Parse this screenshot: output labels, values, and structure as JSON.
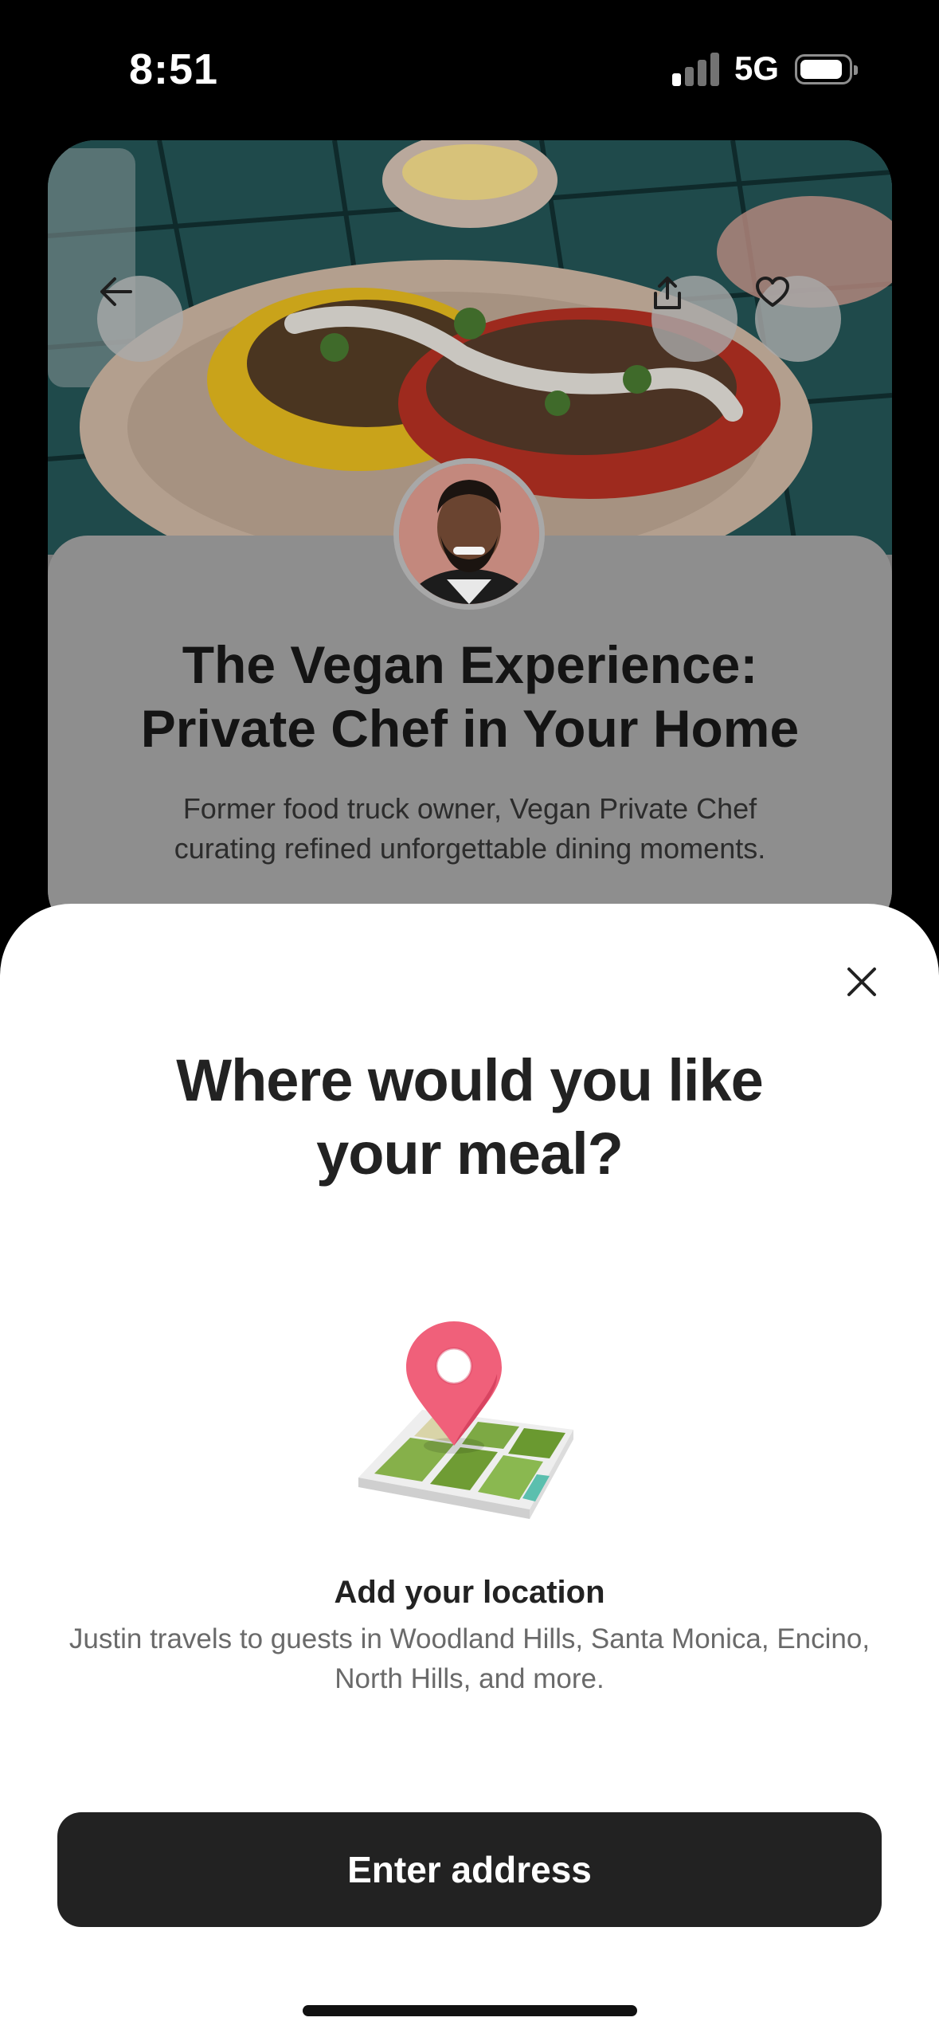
{
  "status_bar": {
    "time": "8:51",
    "network": "5G",
    "battery_level": 0.85
  },
  "listing": {
    "title_line1": "The Vegan Experience:",
    "title_line2": "Private Chef in Your Home",
    "description_line1": "Former food truck owner, Vegan Private Chef",
    "description_line2": "curating refined unforgettable dining moments.",
    "back_icon": "arrow-left-icon",
    "share_icon": "share-icon",
    "favorite_icon": "heart-icon"
  },
  "sheet": {
    "title_line1": "Where would you like",
    "title_line2": "your meal?",
    "close_icon": "close-icon",
    "location_heading": "Add your location",
    "location_desc_line1": "Justin travels to guests in Woodland Hills, Santa Monica, Encino,",
    "location_desc_line2": "North Hills, and more.",
    "cta_label": "Enter address"
  },
  "colors": {
    "cta_background": "#222222",
    "pin": "#f0607a",
    "map_green": "#7aa33a"
  }
}
